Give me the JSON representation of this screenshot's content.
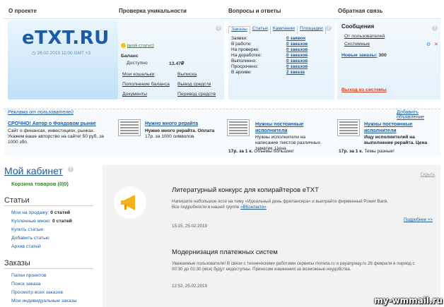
{
  "topnav": {
    "about": "О проекте",
    "uniq": "Проверка уникальности",
    "qa": "Вопросы и ответы",
    "feedback": "Обратная связь"
  },
  "logo": {
    "brand_prefix": "e",
    "brand": "TXT.RU",
    "datetime": "26.02.2019 11:00 GMT +3"
  },
  "profile": {
    "status_link": "[мой статус]",
    "balance_label": "Баланс",
    "available_label": "Доступно",
    "available_value": "13.47₽",
    "links_left": [
      "Мои кошельки",
      "Пополнение баланса",
      "Документы"
    ],
    "links_right": [
      "Выписка",
      "Вывод средств",
      "Перевод средств"
    ]
  },
  "orders": {
    "tabs": [
      "Заказы",
      "Статьи",
      "Кампании",
      "Площадки"
    ],
    "rows": [
      {
        "label": "Заявки:",
        "value": "0 заявок"
      },
      {
        "label": "В работе:",
        "value": "0 заказов"
      },
      {
        "label": "На проверке:",
        "value": "0 заказов"
      },
      {
        "label": "На доработке:",
        "value": "0 заказов"
      },
      {
        "label": "Выполнено:",
        "value": "0 заказов"
      },
      {
        "label": "Просрочено:",
        "value": "0 заказов"
      },
      {
        "label": "В архиве:",
        "value": "2 заказа"
      }
    ]
  },
  "messages": {
    "title": "Сообщения",
    "from_users": "От пользователей",
    "system": "Системные",
    "new_orders_label": "Новые заказы:",
    "new_orders_value": "300",
    "logout": "Выход из системы"
  },
  "ads": {
    "header_left": "Реклама от пользователей",
    "header_right": "Добавить объявление",
    "items": [
      {
        "title": "СРОЧНО! Автор о Фондовом рынке",
        "text": "Сайт о финансах, инвестициях, рынках. Укажем ваше авторство на сайте! 50 руб. за 1000 збп."
      },
      {
        "title": "Нужно много рерайта",
        "bold": "Нужно много рерайта. Оплата",
        "text": "17р. за 1000 символов."
      },
      {
        "title": "Нужны постоянные исполнители",
        "text": "Нужны исполнители на написание текстов различных тематик. Цена",
        "tail_bold": "17р. за 1 к.",
        "tail": "Объемы большие!"
      },
      {
        "title": "Нужны постоянные исполнители",
        "bold": "Ищу исполнителей на выполнение рерайта. Цена",
        "tail_bold": "17р. за 1 к.",
        "tail": "Темы разные!"
      }
    ]
  },
  "cabinet": {
    "title": "Мой кабинет",
    "cart": "Корзина товаров (0|0)",
    "articles_title": "Статьи",
    "articles": [
      {
        "label": "Мои на продажу:",
        "value": "0 статей"
      },
      {
        "label": "Купленные мною:",
        "value": "0 статей"
      }
    ],
    "article_links": [
      "Купить статью",
      "Добавить статью",
      "Архив статей"
    ],
    "orders_title": "Заказы",
    "order_links": [
      "Папки проектов",
      "Поиск заказа",
      "Просмотр всех заказов",
      "Мои индивидуальные заказы"
    ]
  },
  "news": {
    "hide": "Скрыть",
    "items": [
      {
        "title": "Литературный конкурс для копирайтеров eTXT",
        "text1": "Напишите небольшое эссе на тему «Идеальный день фрилансера» и выиграйте фирменный Power Bank.",
        "text2": "Все подробности в нашей группе",
        "link": "«ВКонтакте»",
        "more": "Подробнее >>",
        "date": "15:15, 25.02.2019"
      },
      {
        "title": "Модернизация платежных систем",
        "text1": "Уважаемые пользователи! В связи с техническими работами сервисы moneta.ru и payanyway.ru 26 февраля в период с",
        "text2": "00:30 до 01:30 (мск) будут недоступны. Приносим извинения за возможные неудобства.",
        "date": "12:53, 25.02.2019"
      }
    ]
  },
  "watermark": "my-wmmail.ru"
}
